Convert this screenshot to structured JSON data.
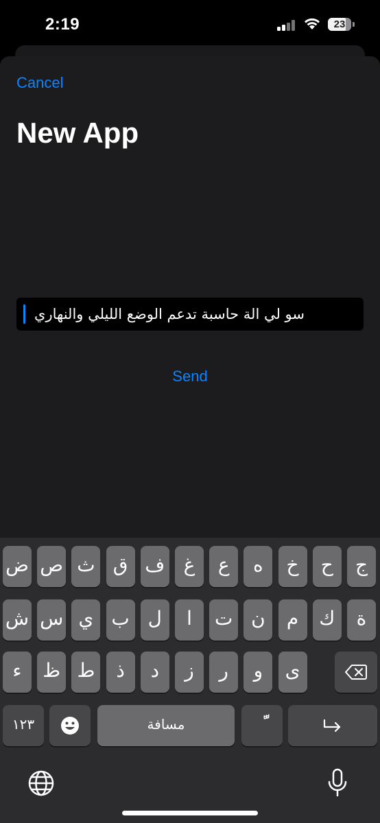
{
  "status": {
    "time": "2:19",
    "battery": "23"
  },
  "sheet": {
    "cancel_label": "Cancel",
    "title": "New App",
    "prompt_value": "سو لي الة حاسبة تدعم الوضع الليلي والنهاري",
    "send_label": "Send"
  },
  "keyboard": {
    "row1": [
      "ض",
      "ص",
      "ث",
      "ق",
      "ف",
      "غ",
      "ع",
      "ه",
      "خ",
      "ح",
      "ج"
    ],
    "row2": [
      "ش",
      "س",
      "ي",
      "ب",
      "ل",
      "ا",
      "ت",
      "ن",
      "م",
      "ك",
      "ة"
    ],
    "row3": [
      "ء",
      "ظ",
      "ط",
      "ذ",
      "د",
      "ز",
      "ر",
      "و",
      "ى"
    ],
    "numbers_label": "١٢٣",
    "space_label": "مسافة",
    "diacritic_label": "ًّ"
  },
  "colors": {
    "accent": "#0a84ff",
    "sheet": "#1c1c1e",
    "key": "#6b6b6e"
  }
}
